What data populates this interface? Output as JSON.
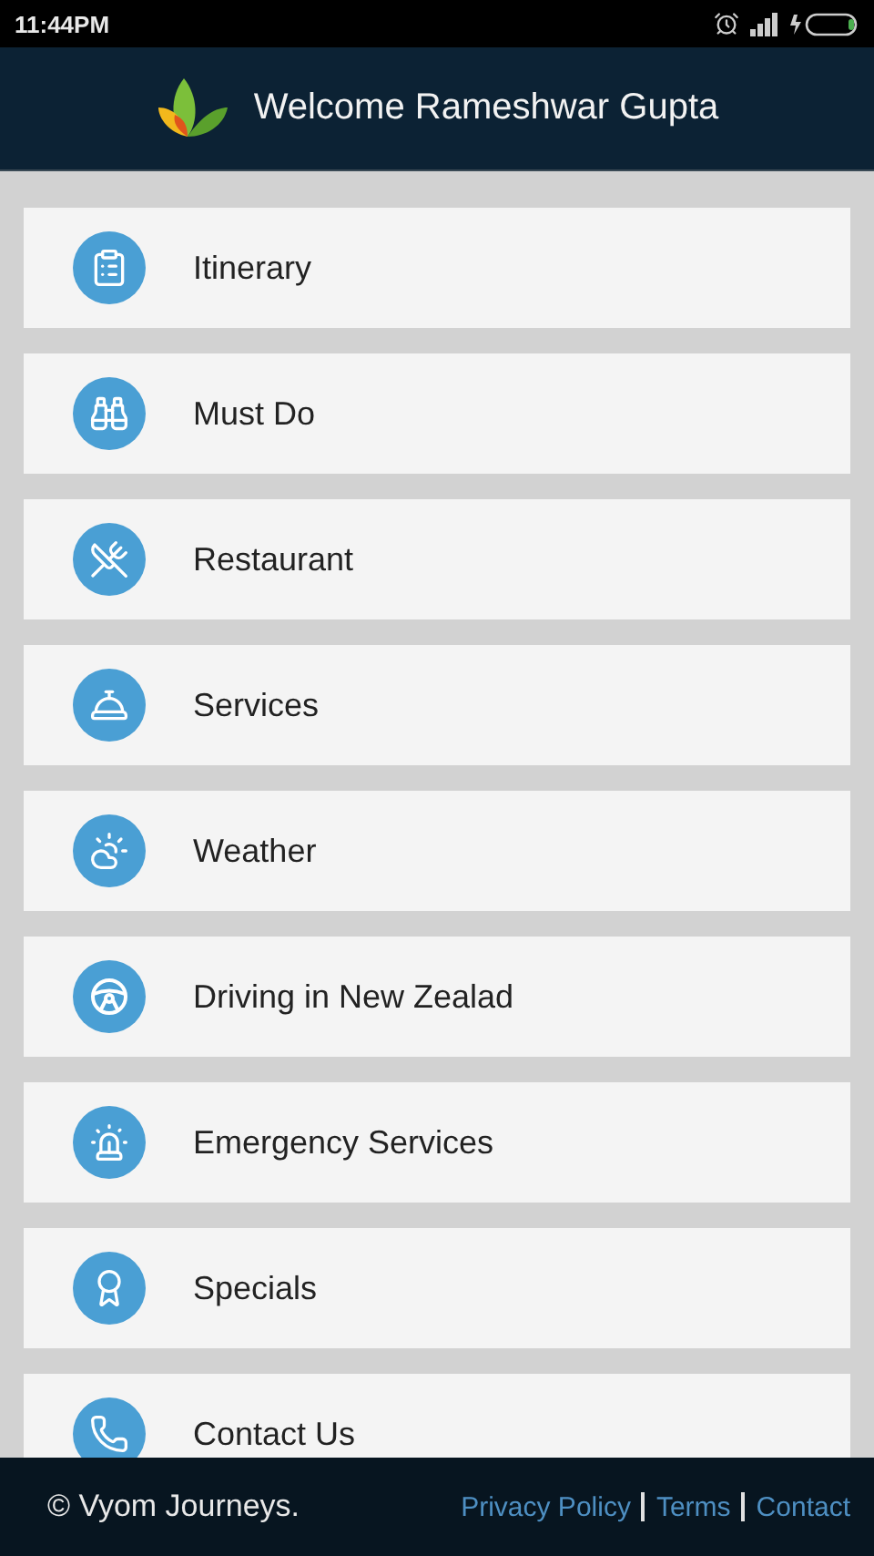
{
  "status_bar": {
    "time": "11:44PM"
  },
  "header": {
    "title": "Welcome Rameshwar Gupta"
  },
  "menu": [
    {
      "label": "Itinerary"
    },
    {
      "label": "Must Do"
    },
    {
      "label": "Restaurant"
    },
    {
      "label": "Services"
    },
    {
      "label": "Weather"
    },
    {
      "label": "Driving in New Zealad"
    },
    {
      "label": "Emergency Services"
    },
    {
      "label": "Specials"
    },
    {
      "label": "Contact Us"
    }
  ],
  "footer": {
    "copyright": "© Vyom Journeys.",
    "links": [
      "Privacy Policy",
      "Terms",
      "Contact"
    ]
  }
}
